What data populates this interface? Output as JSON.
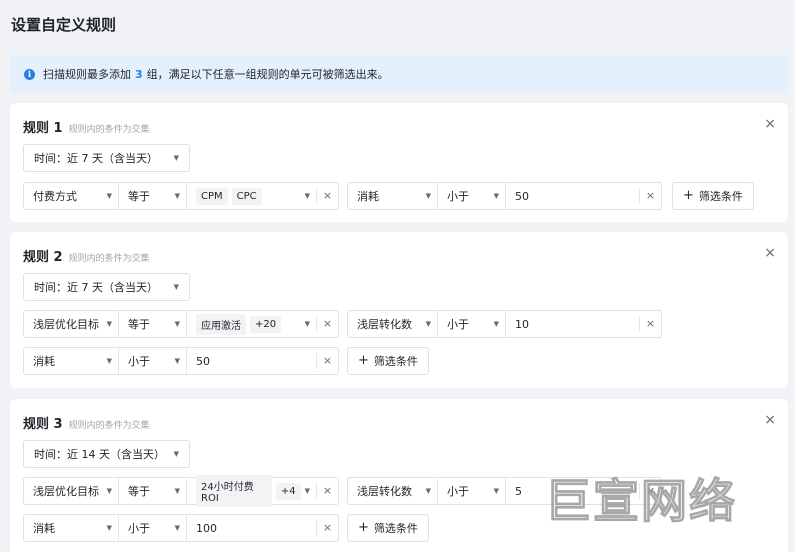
{
  "page": {
    "title": "设置自定义规则"
  },
  "banner": {
    "prefix": "扫描规则最多添加",
    "count": "3",
    "suffix": "组，满足以下任意一组规则的单元可被筛选出来。"
  },
  "common": {
    "subtitle": "规则内的条件为交集",
    "add_filter": "筛选条件",
    "clear": "×",
    "close": "×"
  },
  "rules": [
    {
      "title": "规则 1",
      "time": "时间：近 7 天（含当天）",
      "conditions": [
        {
          "field": "付费方式",
          "op": "等于",
          "tags": [
            "CPM",
            "CPC"
          ]
        },
        {
          "field": "消耗",
          "op": "小于",
          "value": "50"
        }
      ]
    },
    {
      "title": "规则 2",
      "time": "时间：近 7 天（含当天）",
      "conditions": [
        {
          "field": "浅层优化目标",
          "op": "等于",
          "tags": [
            "应用激活",
            "+20"
          ]
        },
        {
          "field": "浅层转化数",
          "op": "小于",
          "value": "10"
        },
        {
          "field": "消耗",
          "op": "小于",
          "value": "50"
        }
      ]
    },
    {
      "title": "规则 3",
      "time": "时间：近 14 天（含当天）",
      "conditions": [
        {
          "field": "浅层优化目标",
          "op": "等于",
          "tags": [
            "24小时付费ROI",
            "+4"
          ]
        },
        {
          "field": "浅层转化数",
          "op": "小于",
          "value": "5"
        },
        {
          "field": "消耗",
          "op": "小于",
          "value": "100"
        }
      ]
    }
  ],
  "watermark": "巨宣网络",
  "colors": {
    "accent": "#2a7ee3",
    "banner_bg": "#e4f0fc",
    "page_bg": "#f0f2f5"
  }
}
